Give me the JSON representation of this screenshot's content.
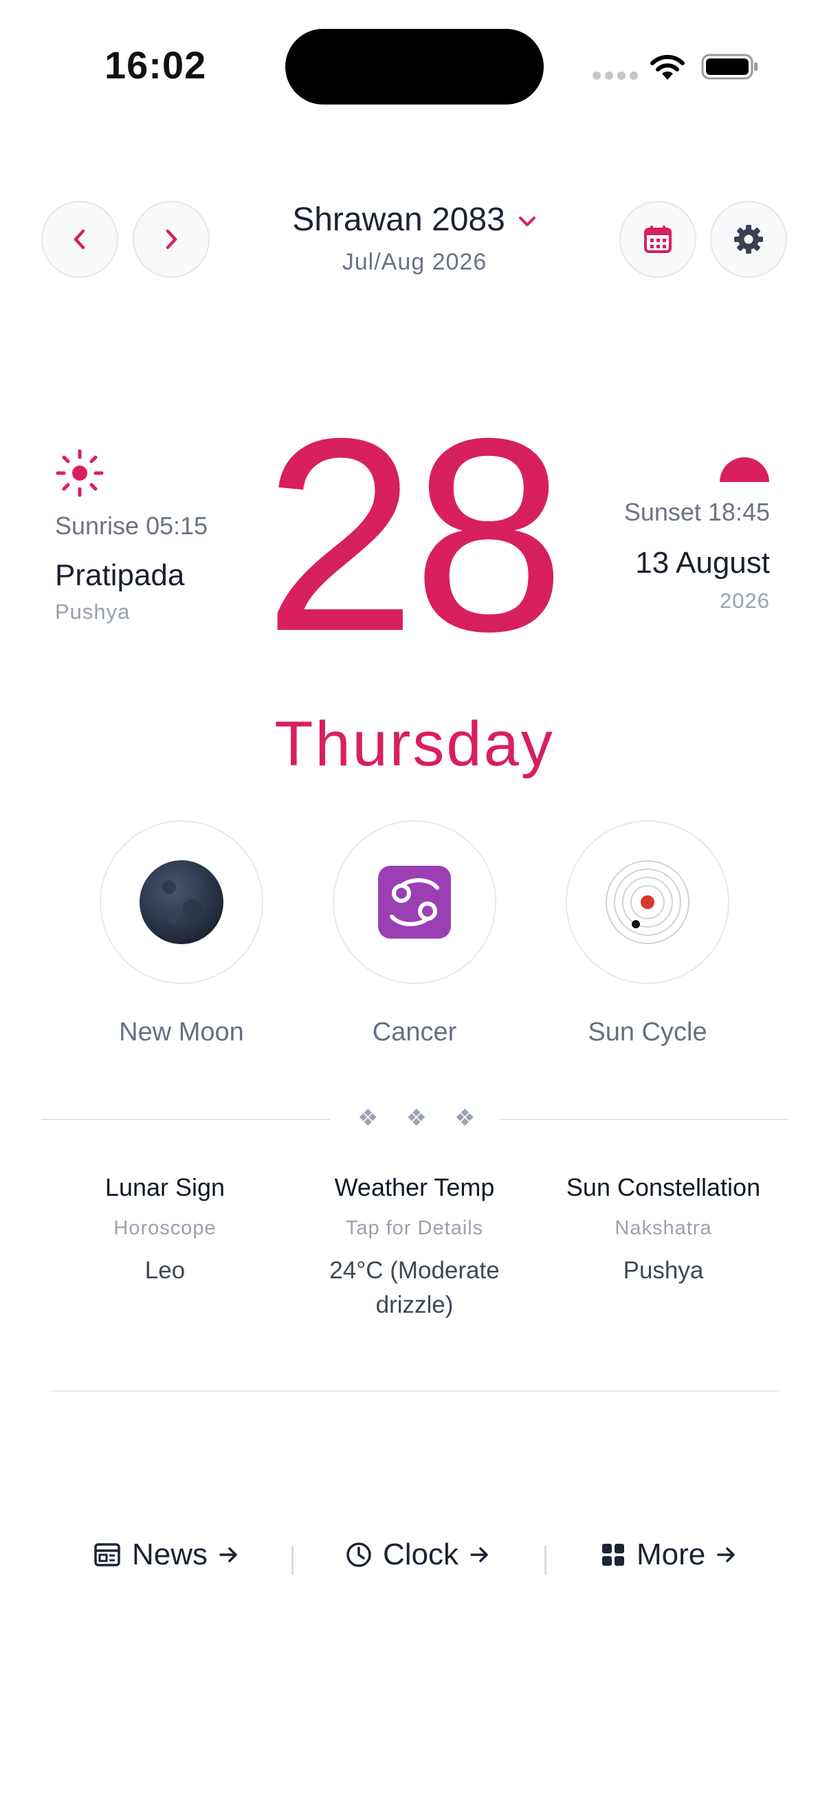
{
  "status_bar": {
    "time": "16:02"
  },
  "header": {
    "month_title": "Shrawan 2083",
    "month_sub": "Jul/Aug 2026",
    "accent_color": "#d81f5f"
  },
  "day": {
    "number": "28",
    "weekday": "Thursday",
    "sunrise": "Sunrise 05:15",
    "tithi": "Pratipada",
    "nakshatra_left": "Pushya",
    "sunset": "Sunset 18:45",
    "ad_date": "13 August",
    "ad_year": "2026"
  },
  "circles": [
    {
      "label": "New Moon",
      "icon": "new-moon-icon"
    },
    {
      "label": "Cancer",
      "icon": "cancer-zodiac-icon"
    },
    {
      "label": "Sun Cycle",
      "icon": "sun-cycle-orbit-icon"
    }
  ],
  "divider": {
    "ornament": "❖   ❖   ❖"
  },
  "info": [
    {
      "title": "Lunar Sign",
      "sub": "Horoscope",
      "value": "Leo"
    },
    {
      "title": "Weather Temp",
      "sub": "Tap for Details",
      "value": "24°C (Moderate drizzle)"
    },
    {
      "title": "Sun Constellation",
      "sub": "Nakshatra",
      "value": "Pushya"
    }
  ],
  "bottom_links": [
    {
      "label": "News",
      "icon": "newspaper-icon"
    },
    {
      "label": "Clock",
      "icon": "clock-icon"
    },
    {
      "label": "More",
      "icon": "grid-icon"
    }
  ]
}
